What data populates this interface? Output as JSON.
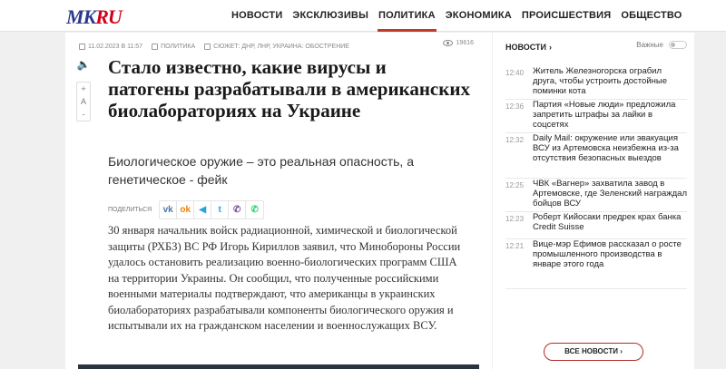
{
  "header": {
    "logo_part1": "MK",
    "logo_part2": "RU",
    "nav": [
      {
        "label": "НОВОСТИ"
      },
      {
        "label": "ЭКСКЛЮЗИВЫ"
      },
      {
        "label": "ПОЛИТИКА",
        "active": true
      },
      {
        "label": "ЭКОНОМИКА"
      },
      {
        "label": "ПРОИСШЕСТВИЯ"
      },
      {
        "label": "ОБЩЕСТВО"
      }
    ]
  },
  "article": {
    "date": "11.02.2023 в 11:57",
    "rubric": "ПОЛИТИКА",
    "story": "СЮЖЕТ: ДНР, ЛНР, УКРАИНА: ОБОСТРЕНИЕ",
    "views": "19616",
    "font_controls": [
      "+",
      "A",
      "-"
    ],
    "title": "Стало известно, какие вирусы и патогены разрабатывали в американских биолабораториях на Украине",
    "lead": "Биологическое оружие – это реальная опасность, а генетическое - фейк",
    "share_label": "ПОДЕЛИТЬСЯ",
    "share_buttons": [
      {
        "name": "vk",
        "glyph": "vk",
        "color": "#4a76a8"
      },
      {
        "name": "ok",
        "glyph": "ok",
        "color": "#ee8208"
      },
      {
        "name": "telegram",
        "glyph": "◀",
        "color": "#2aa3dd"
      },
      {
        "name": "twitter",
        "glyph": "t",
        "color": "#1da1f2"
      },
      {
        "name": "viber",
        "glyph": "✆",
        "color": "#7b519d"
      },
      {
        "name": "whatsapp",
        "glyph": "✆",
        "color": "#25d366"
      }
    ],
    "body": "30 января начальник войск радиационной, химической и биологической защиты (РХБЗ) ВС РФ Игорь Кириллов заявил, что Минобороны России удалось остановить реализацию военно-биологических программ США на территории Украины. Он сообщил, что полученные российскими военными материалы подтверждают, что американцы в украинских биолабораториях разрабатывали компоненты биологического оружия и испытывали их на гражданском населении и военнослужащих ВСУ."
  },
  "sidebar": {
    "title": "НОВОСТИ",
    "title_chevron": "›",
    "important_label": "Важные",
    "news": [
      {
        "time": "12:40",
        "text": "Житель Железногорска ограбил друга, чтобы устроить достойные поминки кота"
      },
      {
        "time": "12:36",
        "text": "Партия «Новые люди» предложила запретить штрафы за лайки в соцсетях"
      },
      {
        "time": "12:32",
        "text": "Daily Mail: окружение или эвакуация ВСУ из Артемовска неизбежна из-за отсутствия безопасных выездов"
      },
      {
        "time": "12:25",
        "text": "ЧВК «Вагнер» захватила завод в Артемовске, где Зеленский награждал бойцов ВСУ"
      },
      {
        "time": "12:23",
        "text": "Роберт Кийосаки предрек крах банка Credit Suisse"
      },
      {
        "time": "12:21",
        "text": "Вице-мэр Ефимов рассказал о росте промышленного производства в январе этого года"
      }
    ],
    "all_news_label": "ВСЕ НОВОСТИ ›"
  }
}
